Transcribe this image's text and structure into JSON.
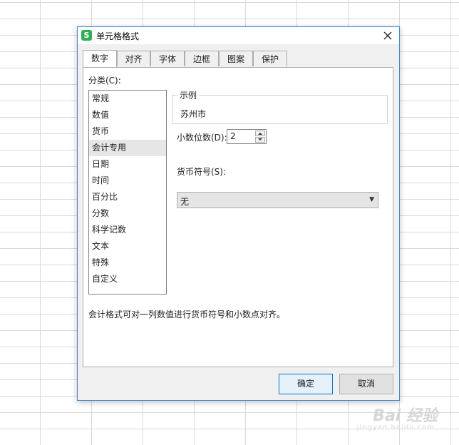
{
  "dialog": {
    "title": "单元格格式",
    "app_icon_letter": "S",
    "close_glyph": "✕"
  },
  "tabs": [
    "数字",
    "对齐",
    "字体",
    "边框",
    "图案",
    "保护"
  ],
  "active_tab": 0,
  "number_panel": {
    "category_label": "分类(C):",
    "categories": [
      "常规",
      "数值",
      "货币",
      "会计专用",
      "日期",
      "时间",
      "百分比",
      "分数",
      "科学记数",
      "文本",
      "特殊",
      "自定义"
    ],
    "selected_category": 3,
    "sample_legend": "示例",
    "sample_value": "苏州市",
    "decimal_label": "小数位数(D):",
    "decimal_value": "2",
    "currency_label": "货币符号(S):",
    "currency_value": "无",
    "description": "会计格式可对一列数值进行货币符号和小数点对齐。"
  },
  "buttons": {
    "ok": "确定",
    "cancel": "取消"
  },
  "watermark": {
    "text": "Bai 经验",
    "sub": "jingyan.baidu.com"
  }
}
